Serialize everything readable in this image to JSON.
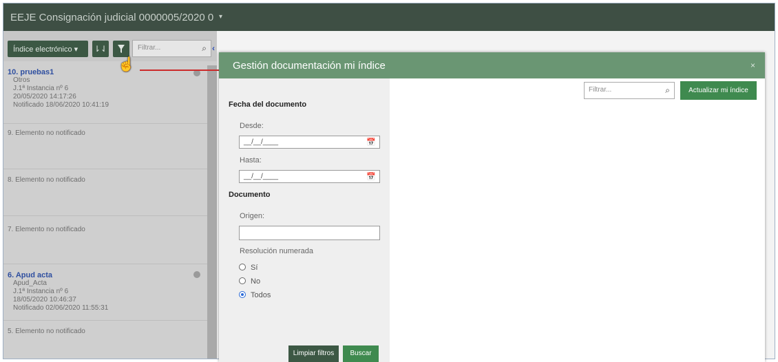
{
  "window": {
    "title": "EEJE Consignación judicial 0000005/2020 0",
    "title_caret": "▾"
  },
  "left_panel": {
    "indice_button": "Índice electrónico ▾",
    "sort_icon_glyph": "⇂⇃",
    "filter_placeholder": "Filtrar...",
    "collapse_glyph": "‹",
    "items": [
      {
        "title": "10. pruebas1",
        "lines": [
          "Otros",
          "J.1ª Instancia nº 6",
          "20/05/2020 14:17:26",
          "Notificado 18/06/2020 10:41:19"
        ]
      },
      {
        "title": "9. Elemento no notificado"
      },
      {
        "title": "8. Elemento no notificado"
      },
      {
        "title": "7. Elemento no notificado"
      },
      {
        "title": "6. Apud acta",
        "lines": [
          "Apud_Acta",
          "J.1ª Instancia nº 6",
          "18/05/2020 10:46:37",
          "Notificado 02/06/2020 11:55:31"
        ]
      },
      {
        "title": "5. Elemento no notificado"
      }
    ]
  },
  "modal": {
    "title": "Gestión documentación mi índice",
    "close_label": "×",
    "filters": {
      "fecha_title": "Fecha del documento",
      "desde_label": "Desde:",
      "desde_value": "__/__/____",
      "hasta_label": "Hasta:",
      "hasta_value": "__/__/____",
      "documento_title": "Documento",
      "origen_label": "Origen:",
      "origen_value": "",
      "resolucion_label": "Resolución numerada",
      "options": [
        "Sí",
        "No",
        "Todos"
      ],
      "selected": "Todos",
      "clear_button": "Limpiar filtros",
      "search_button": "Buscar"
    },
    "main": {
      "filter_placeholder": "Filtrar...",
      "update_button": "Actualizar mi índice"
    }
  },
  "colors": {
    "topbar": "#3e4f44",
    "modal_header": "#6a9673",
    "primary_button": "#3f8a4f",
    "dark_button": "#3c5844"
  }
}
